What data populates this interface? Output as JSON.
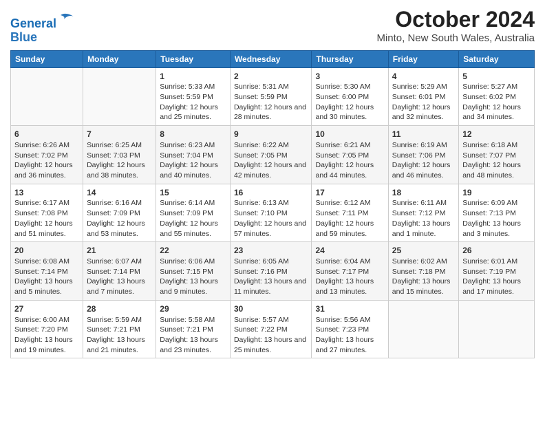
{
  "logo": {
    "text_general": "General",
    "text_blue": "Blue"
  },
  "title": "October 2024",
  "subtitle": "Minto, New South Wales, Australia",
  "days_of_week": [
    "Sunday",
    "Monday",
    "Tuesday",
    "Wednesday",
    "Thursday",
    "Friday",
    "Saturday"
  ],
  "weeks": [
    [
      {
        "day": "",
        "sunrise": "",
        "sunset": "",
        "daylight": ""
      },
      {
        "day": "",
        "sunrise": "",
        "sunset": "",
        "daylight": ""
      },
      {
        "day": "1",
        "sunrise": "Sunrise: 5:33 AM",
        "sunset": "Sunset: 5:59 PM",
        "daylight": "Daylight: 12 hours and 25 minutes."
      },
      {
        "day": "2",
        "sunrise": "Sunrise: 5:31 AM",
        "sunset": "Sunset: 5:59 PM",
        "daylight": "Daylight: 12 hours and 28 minutes."
      },
      {
        "day": "3",
        "sunrise": "Sunrise: 5:30 AM",
        "sunset": "Sunset: 6:00 PM",
        "daylight": "Daylight: 12 hours and 30 minutes."
      },
      {
        "day": "4",
        "sunrise": "Sunrise: 5:29 AM",
        "sunset": "Sunset: 6:01 PM",
        "daylight": "Daylight: 12 hours and 32 minutes."
      },
      {
        "day": "5",
        "sunrise": "Sunrise: 5:27 AM",
        "sunset": "Sunset: 6:02 PM",
        "daylight": "Daylight: 12 hours and 34 minutes."
      }
    ],
    [
      {
        "day": "6",
        "sunrise": "Sunrise: 6:26 AM",
        "sunset": "Sunset: 7:02 PM",
        "daylight": "Daylight: 12 hours and 36 minutes."
      },
      {
        "day": "7",
        "sunrise": "Sunrise: 6:25 AM",
        "sunset": "Sunset: 7:03 PM",
        "daylight": "Daylight: 12 hours and 38 minutes."
      },
      {
        "day": "8",
        "sunrise": "Sunrise: 6:23 AM",
        "sunset": "Sunset: 7:04 PM",
        "daylight": "Daylight: 12 hours and 40 minutes."
      },
      {
        "day": "9",
        "sunrise": "Sunrise: 6:22 AM",
        "sunset": "Sunset: 7:05 PM",
        "daylight": "Daylight: 12 hours and 42 minutes."
      },
      {
        "day": "10",
        "sunrise": "Sunrise: 6:21 AM",
        "sunset": "Sunset: 7:05 PM",
        "daylight": "Daylight: 12 hours and 44 minutes."
      },
      {
        "day": "11",
        "sunrise": "Sunrise: 6:19 AM",
        "sunset": "Sunset: 7:06 PM",
        "daylight": "Daylight: 12 hours and 46 minutes."
      },
      {
        "day": "12",
        "sunrise": "Sunrise: 6:18 AM",
        "sunset": "Sunset: 7:07 PM",
        "daylight": "Daylight: 12 hours and 48 minutes."
      }
    ],
    [
      {
        "day": "13",
        "sunrise": "Sunrise: 6:17 AM",
        "sunset": "Sunset: 7:08 PM",
        "daylight": "Daylight: 12 hours and 51 minutes."
      },
      {
        "day": "14",
        "sunrise": "Sunrise: 6:16 AM",
        "sunset": "Sunset: 7:09 PM",
        "daylight": "Daylight: 12 hours and 53 minutes."
      },
      {
        "day": "15",
        "sunrise": "Sunrise: 6:14 AM",
        "sunset": "Sunset: 7:09 PM",
        "daylight": "Daylight: 12 hours and 55 minutes."
      },
      {
        "day": "16",
        "sunrise": "Sunrise: 6:13 AM",
        "sunset": "Sunset: 7:10 PM",
        "daylight": "Daylight: 12 hours and 57 minutes."
      },
      {
        "day": "17",
        "sunrise": "Sunrise: 6:12 AM",
        "sunset": "Sunset: 7:11 PM",
        "daylight": "Daylight: 12 hours and 59 minutes."
      },
      {
        "day": "18",
        "sunrise": "Sunrise: 6:11 AM",
        "sunset": "Sunset: 7:12 PM",
        "daylight": "Daylight: 13 hours and 1 minute."
      },
      {
        "day": "19",
        "sunrise": "Sunrise: 6:09 AM",
        "sunset": "Sunset: 7:13 PM",
        "daylight": "Daylight: 13 hours and 3 minutes."
      }
    ],
    [
      {
        "day": "20",
        "sunrise": "Sunrise: 6:08 AM",
        "sunset": "Sunset: 7:14 PM",
        "daylight": "Daylight: 13 hours and 5 minutes."
      },
      {
        "day": "21",
        "sunrise": "Sunrise: 6:07 AM",
        "sunset": "Sunset: 7:14 PM",
        "daylight": "Daylight: 13 hours and 7 minutes."
      },
      {
        "day": "22",
        "sunrise": "Sunrise: 6:06 AM",
        "sunset": "Sunset: 7:15 PM",
        "daylight": "Daylight: 13 hours and 9 minutes."
      },
      {
        "day": "23",
        "sunrise": "Sunrise: 6:05 AM",
        "sunset": "Sunset: 7:16 PM",
        "daylight": "Daylight: 13 hours and 11 minutes."
      },
      {
        "day": "24",
        "sunrise": "Sunrise: 6:04 AM",
        "sunset": "Sunset: 7:17 PM",
        "daylight": "Daylight: 13 hours and 13 minutes."
      },
      {
        "day": "25",
        "sunrise": "Sunrise: 6:02 AM",
        "sunset": "Sunset: 7:18 PM",
        "daylight": "Daylight: 13 hours and 15 minutes."
      },
      {
        "day": "26",
        "sunrise": "Sunrise: 6:01 AM",
        "sunset": "Sunset: 7:19 PM",
        "daylight": "Daylight: 13 hours and 17 minutes."
      }
    ],
    [
      {
        "day": "27",
        "sunrise": "Sunrise: 6:00 AM",
        "sunset": "Sunset: 7:20 PM",
        "daylight": "Daylight: 13 hours and 19 minutes."
      },
      {
        "day": "28",
        "sunrise": "Sunrise: 5:59 AM",
        "sunset": "Sunset: 7:21 PM",
        "daylight": "Daylight: 13 hours and 21 minutes."
      },
      {
        "day": "29",
        "sunrise": "Sunrise: 5:58 AM",
        "sunset": "Sunset: 7:21 PM",
        "daylight": "Daylight: 13 hours and 23 minutes."
      },
      {
        "day": "30",
        "sunrise": "Sunrise: 5:57 AM",
        "sunset": "Sunset: 7:22 PM",
        "daylight": "Daylight: 13 hours and 25 minutes."
      },
      {
        "day": "31",
        "sunrise": "Sunrise: 5:56 AM",
        "sunset": "Sunset: 7:23 PM",
        "daylight": "Daylight: 13 hours and 27 minutes."
      },
      {
        "day": "",
        "sunrise": "",
        "sunset": "",
        "daylight": ""
      },
      {
        "day": "",
        "sunrise": "",
        "sunset": "",
        "daylight": ""
      }
    ]
  ]
}
